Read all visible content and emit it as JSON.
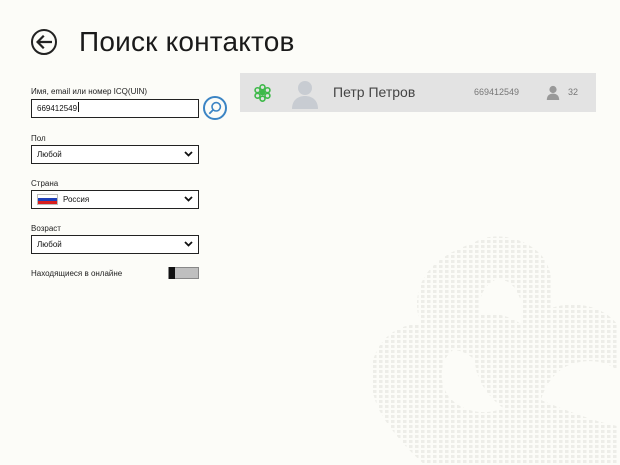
{
  "header": {
    "title": "Поиск контактов",
    "back_icon": "arrow-left-circle-icon"
  },
  "form": {
    "uin_label": "Имя, email или номер ICQ(UIN)",
    "uin_value": "669412549",
    "search_icon": "magnifier-icon",
    "gender_label": "Пол",
    "gender_value": "Любой",
    "country_label": "Страна",
    "country_value": "Россия",
    "country_flag_icon": "russia-flag-icon",
    "age_label": "Возраст",
    "age_value": "Любой",
    "online_label": "Находящиеся в онлайне",
    "online_toggle_on": false
  },
  "results": [
    {
      "name": "Петр Петров",
      "uin": "669412549",
      "age": "32",
      "status_icon": "icq-flower-icon",
      "avatar_icon": "default-avatar-icon"
    }
  ],
  "colors": {
    "accent": "#3b84c4",
    "status_green": "#3fb94a",
    "result_bg": "#e3e3e3"
  }
}
